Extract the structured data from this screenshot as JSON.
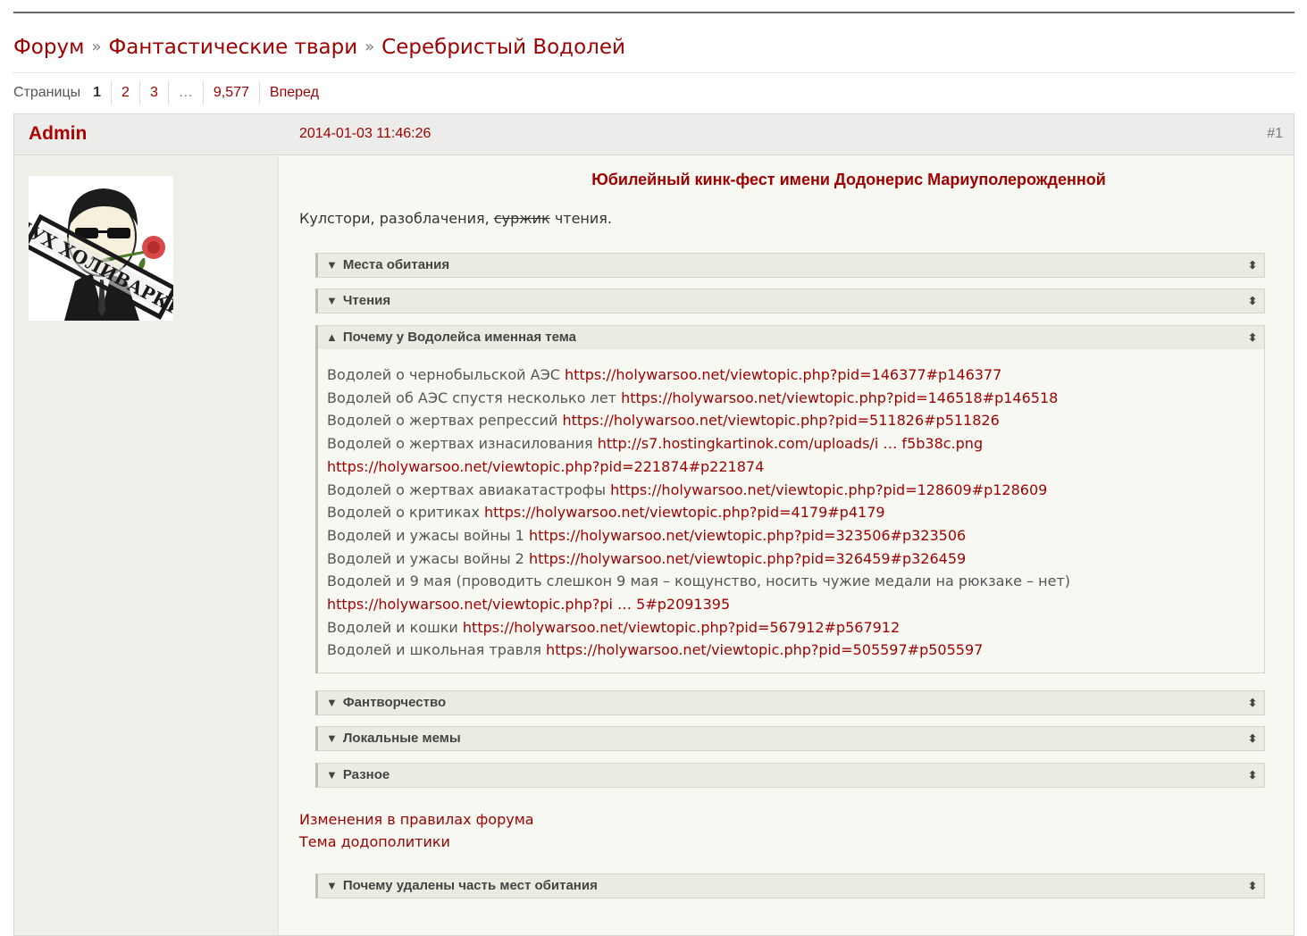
{
  "breadcrumbs": [
    "Форум",
    "Фантастические твари",
    "Серебристый Водолей"
  ],
  "breadcrumb_sep": "»",
  "pagination": {
    "label": "Страницы",
    "current": "1",
    "pages": [
      "2",
      "3"
    ],
    "ellipsis": "…",
    "last": "9,577",
    "next": "Вперед"
  },
  "post": {
    "author": "Admin",
    "date": "2014-01-03 11:46:26",
    "number": "#1",
    "avatar_text": "ДУХ ХОЛИВАРКИ",
    "title": "Юбилейный кинк-фест имени Додонерис Мариуполерожденной",
    "intro_start": "Кулстори, разоблачения,",
    "intro_struck": "суржик",
    "intro_end": "чтения.",
    "spoilers": [
      {
        "label": "Места обитания",
        "arrow": "▼",
        "toggle": "⬍"
      },
      {
        "label": "Чтения",
        "arrow": "▼",
        "toggle": "⬍"
      },
      {
        "label": "Почему у Водолейса именная тема",
        "arrow": "▲",
        "toggle": "⬍"
      },
      {
        "label": "Фантворчество",
        "arrow": "▼",
        "toggle": "⬍"
      },
      {
        "label": "Локальные мемы",
        "arrow": "▼",
        "toggle": "⬍"
      },
      {
        "label": "Разное",
        "arrow": "▼",
        "toggle": "⬍"
      },
      {
        "label": "Почему удалены часть мест обитания",
        "arrow": "▼",
        "toggle": "⬍"
      }
    ],
    "open_spoiler_lines": [
      {
        "text": "Водолей о чернобыльской АЭС",
        "link": "https://holywarsoo.net/viewtopic.php?pid=146377#p146377"
      },
      {
        "text": "Водолей об АЭС спустя несколько лет",
        "link": "https://holywarsoo.net/viewtopic.php?pid=146518#p146518"
      },
      {
        "text": "Водолей о жертвах репрессий",
        "link": "https://holywarsoo.net/viewtopic.php?pid=511826#p511826"
      },
      {
        "text": "Водолей о жертвах изнасилования",
        "link": "http://s7.hostingkartinok.com/uploads/i … f5b38c.png"
      },
      {
        "text": "",
        "link": "https://holywarsoo.net/viewtopic.php?pid=221874#p221874"
      },
      {
        "text": "Водолей о жертвах авиакатастрофы",
        "link": "https://holywarsoo.net/viewtopic.php?pid=128609#p128609"
      },
      {
        "text": "Водолей о критиках",
        "link": "https://holywarsoo.net/viewtopic.php?pid=4179#p4179"
      },
      {
        "text": "Водолей и ужасы войны 1",
        "link": "https://holywarsoo.net/viewtopic.php?pid=323506#p323506"
      },
      {
        "text": "Водолей и ужасы войны 2",
        "link": "https://holywarsoo.net/viewtopic.php?pid=326459#p326459"
      },
      {
        "text": "Водолей и 9 мая (проводить слешкон 9 мая – кощунство, носить чужие медали на рюкзаке – нет)",
        "link": ""
      },
      {
        "text": "",
        "link": "https://holywarsoo.net/viewtopic.php?pi … 5#p2091395"
      },
      {
        "text": "Водолей и кошки",
        "link": "https://holywarsoo.net/viewtopic.php?pid=567912#p567912"
      },
      {
        "text": "Водолей и школьная травля",
        "link": "https://holywarsoo.net/viewtopic.php?pid=505597#p505597"
      }
    ],
    "footer_links": [
      "Изменения в правилах форума",
      "Тема додополитики"
    ]
  },
  "colors": {
    "accent": "#9e0000",
    "author": "#b00000",
    "post_bg": "#f8f8f3",
    "header_bg": "#ececea"
  }
}
